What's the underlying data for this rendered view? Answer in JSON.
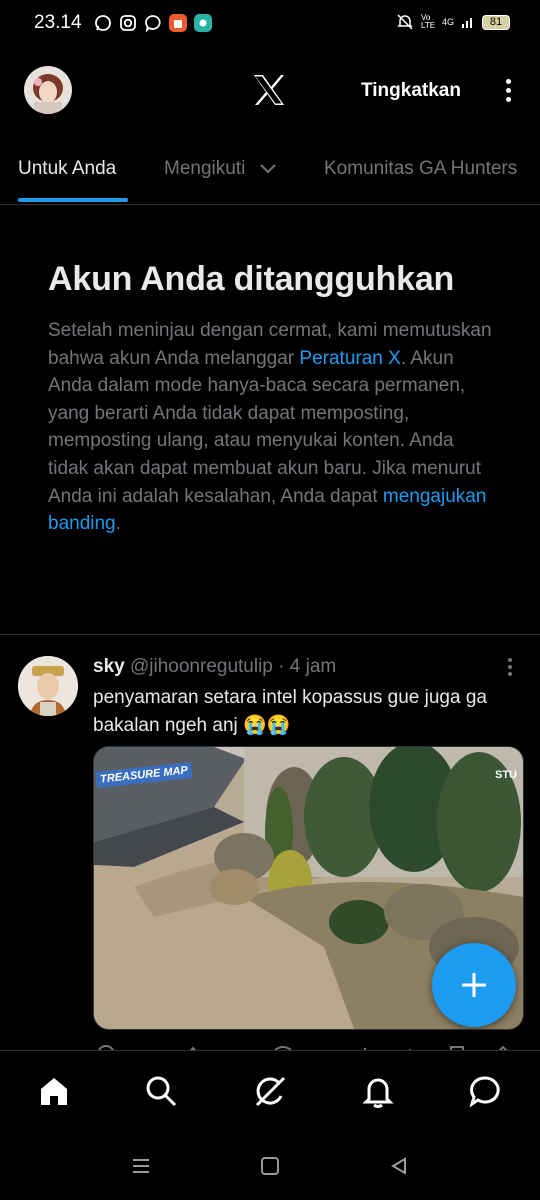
{
  "status_bar": {
    "time": "23.14",
    "network": "4G",
    "volte": "Vo LTE",
    "battery": "81"
  },
  "header": {
    "upgrade_label": "Tingkatkan"
  },
  "tabs": [
    {
      "label": "Untuk Anda",
      "active": true
    },
    {
      "label": "Mengikuti",
      "active": false
    },
    {
      "label": "Komunitas GA Hunters",
      "active": false
    }
  ],
  "notice": {
    "title": "Akun Anda ditangguhkan",
    "body_1": "Setelah meninjau dengan cermat, kami memutuskan bahwa akun Anda melanggar ",
    "link_rules": "Peraturan X",
    "body_2": ". Akun Anda dalam mode hanya-baca secara permanen, yang berarti Anda tidak dapat memposting, memposting ulang, atau menyukai konten. Anda tidak akan dapat membuat akun baru. Jika menurut Anda ini adalah kesalahan, Anda dapat ",
    "link_appeal": "mengajukan banding",
    "body_3": "."
  },
  "post": {
    "name": "sky",
    "handle": "@jihoonregutulip",
    "separator": "·",
    "time": "4 jam",
    "text": "penyamaran setara intel kopassus gue juga ga bakalan ngeh anj 😭😭",
    "media_logo": "TREASURE MAP",
    "media_corner": "STU"
  },
  "colors": {
    "accent": "#1d9bf0",
    "background": "#000000",
    "text_primary": "#e7e9ea",
    "text_secondary": "#71767b"
  },
  "icons": {
    "header_logo": "x-logo-icon",
    "tab_dropdown": "chevron-down-icon",
    "fab": "plus-icon",
    "nav": [
      "home-icon",
      "search-icon",
      "grok-icon",
      "notifications-icon",
      "messages-icon"
    ]
  }
}
